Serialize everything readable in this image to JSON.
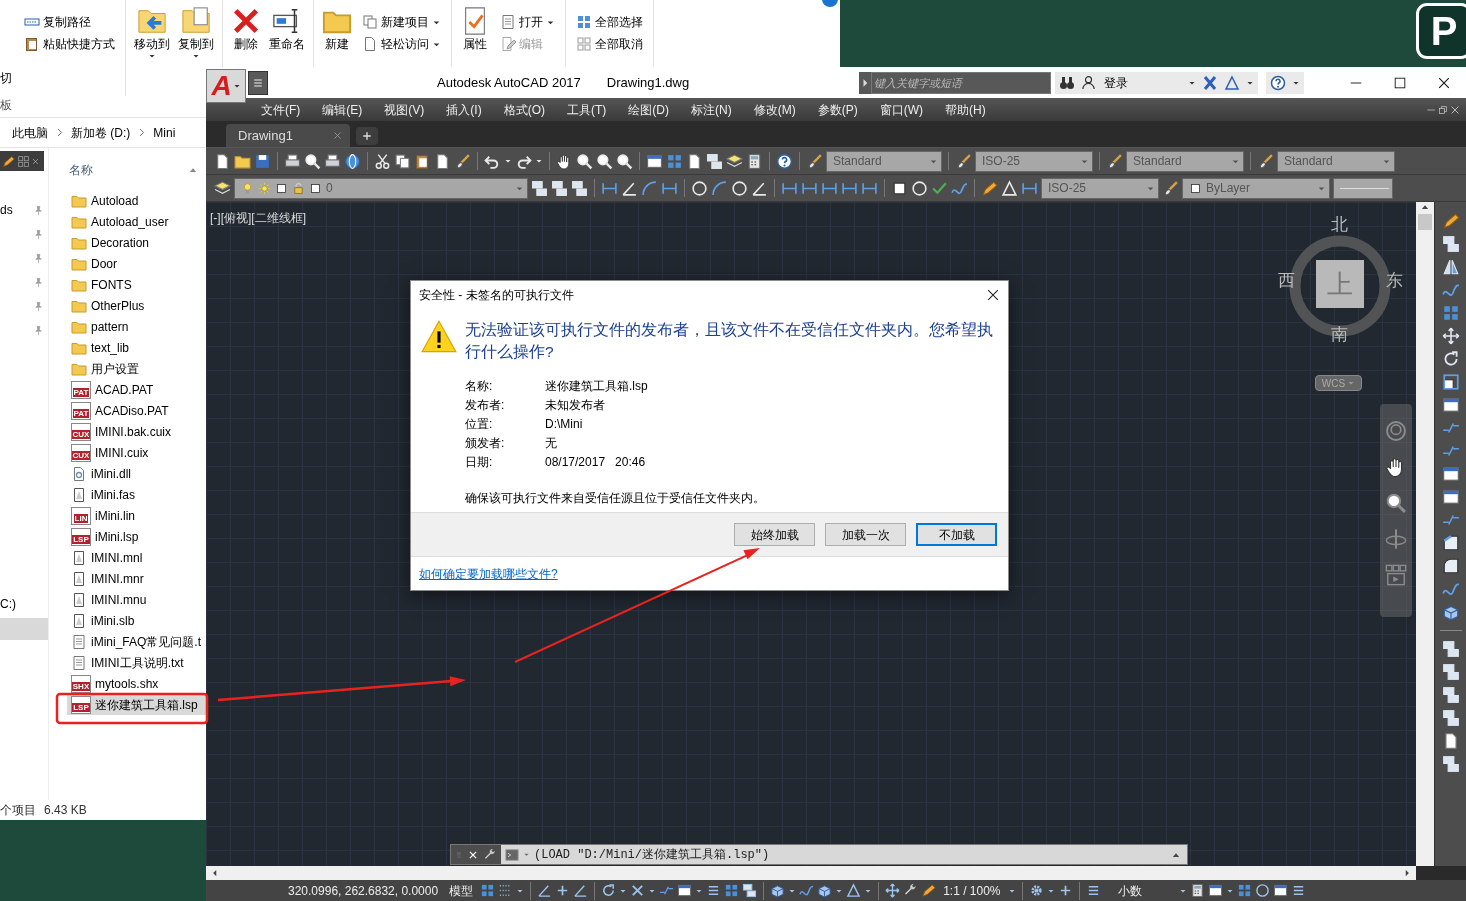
{
  "explorer": {
    "ribbon": {
      "clipped_labels": [
        "切",
        "板"
      ],
      "groups": [
        {
          "small_items": [
            {
              "label": "复制路径",
              "dropdown": false,
              "disabled": false
            },
            {
              "label": "粘贴快捷方式",
              "dropdown": false,
              "disabled": false
            }
          ]
        },
        {
          "large_items": [
            {
              "label": "移动到",
              "dropdown": true
            },
            {
              "label": "复制到",
              "dropdown": true
            }
          ]
        },
        {
          "large_items": [
            {
              "label": "删除",
              "dropdown": false
            },
            {
              "label": "重命名",
              "dropdown": false
            }
          ]
        },
        {
          "large_items": [
            {
              "label": "新建",
              "dropdown": false
            }
          ],
          "small_items": [
            {
              "label": "新建项目",
              "dropdown": true,
              "disabled": false
            },
            {
              "label": "轻松访问",
              "dropdown": true,
              "disabled": false
            }
          ]
        },
        {
          "large_items": [
            {
              "label": "属性",
              "dropdown": false
            }
          ],
          "small_items": [
            {
              "label": "打开",
              "dropdown": true,
              "disabled": false
            },
            {
              "label": "编辑",
              "dropdown": false,
              "disabled": true
            }
          ]
        },
        {
          "small_items": [
            {
              "label": "全部选择",
              "dropdown": false,
              "disabled": false
            },
            {
              "label": "全部取消",
              "dropdown": false,
              "disabled": false
            }
          ]
        }
      ]
    },
    "address": [
      "此电脑",
      "新加卷 (D:)",
      "Mini"
    ],
    "nav": {
      "quick_access_label": "ds",
      "drive_label": "C:)"
    },
    "column_header": "名称",
    "files": [
      {
        "name": "Autoload",
        "kind": "folder",
        "selected": false
      },
      {
        "name": "Autoload_user",
        "kind": "folder",
        "selected": false
      },
      {
        "name": "Decoration",
        "kind": "folder",
        "selected": false
      },
      {
        "name": "Door",
        "kind": "folder",
        "selected": false
      },
      {
        "name": "FONTS",
        "kind": "folder",
        "selected": false
      },
      {
        "name": "OtherPlus",
        "kind": "folder",
        "selected": false
      },
      {
        "name": "pattern",
        "kind": "folder",
        "selected": false
      },
      {
        "name": "text_lib",
        "kind": "folder",
        "selected": false
      },
      {
        "name": "用户设置",
        "kind": "folder",
        "selected": false
      },
      {
        "name": "ACAD.PAT",
        "kind": "badge",
        "badge": "PAT",
        "selected": false
      },
      {
        "name": "ACADiso.PAT",
        "kind": "badge",
        "badge": "PAT",
        "selected": false
      },
      {
        "name": "IMINI.bak.cuix",
        "kind": "badge",
        "badge": "CUX",
        "selected": false
      },
      {
        "name": "IMINI.cuix",
        "kind": "badge",
        "badge": "CUX",
        "selected": false
      },
      {
        "name": "iMini.dll",
        "kind": "dll",
        "selected": false
      },
      {
        "name": "iMini.fas",
        "kind": "generic",
        "selected": false
      },
      {
        "name": "iMini.lin",
        "kind": "badge",
        "badge": "LIN",
        "selected": false
      },
      {
        "name": "iMini.lsp",
        "kind": "badge",
        "badge": "LSP",
        "selected": false
      },
      {
        "name": "IMINI.mnl",
        "kind": "generic",
        "selected": false
      },
      {
        "name": "IMINI.mnr",
        "kind": "generic",
        "selected": false
      },
      {
        "name": "IMINI.mnu",
        "kind": "generic",
        "selected": false
      },
      {
        "name": "iMini.slb",
        "kind": "generic",
        "selected": false
      },
      {
        "name": "iMini_FAQ常见问题.t",
        "kind": "text",
        "selected": false
      },
      {
        "name": "IMINI工具说明.txt",
        "kind": "text",
        "selected": false
      },
      {
        "name": "mytools.shx",
        "kind": "badge",
        "badge": "SHX",
        "selected": false
      },
      {
        "name": "迷你建筑工具箱.lsp",
        "kind": "badge",
        "badge": "LSP",
        "selected": true
      }
    ],
    "status": "个项目",
    "size": "6.43 KB"
  },
  "autocad": {
    "app_letter": "A",
    "title": "Autodesk AutoCAD 2017",
    "document": "Drawing1.dwg",
    "search_placeholder": "键入关键字或短语",
    "sign_in": "登录",
    "menu": [
      "文件(F)",
      "编辑(E)",
      "视图(V)",
      "插入(I)",
      "格式(O)",
      "工具(T)",
      "绘图(D)",
      "标注(N)",
      "修改(M)",
      "参数(P)",
      "窗口(W)",
      "帮助(H)"
    ],
    "tabs": [
      {
        "label": "Drawing1",
        "selected": true
      }
    ],
    "style_dropdowns": [
      "Standard",
      "ISO-25",
      "Standard",
      "Standard"
    ],
    "layer": "0",
    "dim_style": "ISO-25",
    "color_setting": "ByLayer",
    "viewport_label": "[-][俯视][二维线框]",
    "viewcube": {
      "north": "北",
      "west": "西",
      "east": "东",
      "south": "南",
      "face": "上",
      "ucs": "WCS"
    },
    "command_line": "(LOAD \"D:/Mini/迷你建筑工具箱.lsp\")",
    "status_bar": {
      "coordinates": "320.0996, 262.6832, 0.0000",
      "space": "模型",
      "annotation_scale": "1:1 / 100%",
      "units": "小数"
    }
  },
  "dialog": {
    "title": "安全性 - 未签名的可执行文件",
    "message": "无法验证该可执行文件的发布者，且该文件不在受信任文件夹内。您希望执行什么操作?",
    "fields": [
      {
        "label": "名称:",
        "value": "迷你建筑工具箱.lsp"
      },
      {
        "label": "发布者:",
        "value": "未知发布者"
      },
      {
        "label": "位置:",
        "value": "D:\\Mini"
      },
      {
        "label": "颁发者:",
        "value": "无"
      },
      {
        "label": "日期:",
        "value": "08/17/2017   20:46"
      }
    ],
    "note": "确保该可执行文件来自受信任源且位于受信任文件夹内。",
    "buttons": [
      {
        "label": "始终加载",
        "default": false
      },
      {
        "label": "加载一次",
        "default": false
      },
      {
        "label": "不加载",
        "default": true
      }
    ],
    "link": "如何确定要加载哪些文件?"
  },
  "corner_logo": {
    "letter": "P"
  }
}
